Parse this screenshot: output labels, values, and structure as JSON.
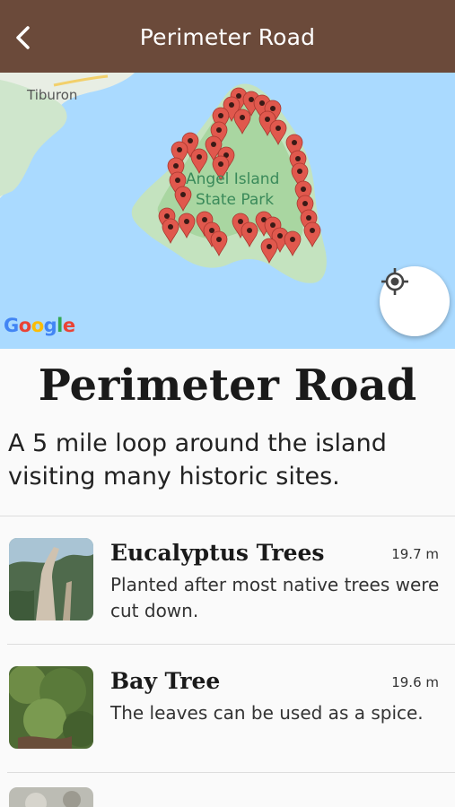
{
  "header": {
    "title": "Perimeter Road",
    "back_icon": "chevron-left-icon"
  },
  "map": {
    "labels": {
      "tiburon": "Tiburon",
      "park_line1": "Angel Island",
      "park_line2": "State Park",
      "attribution": "Google"
    },
    "colors": {
      "water": "#aadaff",
      "land": "#c9e8c4",
      "park": "#a8d8a0",
      "marker": "#e0584d"
    },
    "locate_icon": "my-location-icon"
  },
  "route": {
    "title": "Perimeter Road",
    "description": "A 5 mile loop around the island visiting many historic sites."
  },
  "points": [
    {
      "name": "Eucalyptus Trees",
      "distance": "19.7 m",
      "description": "Planted after most native trees were cut down."
    },
    {
      "name": "Bay Tree",
      "distance": "19.6 m",
      "description": "The leaves can be used as a spice."
    }
  ]
}
